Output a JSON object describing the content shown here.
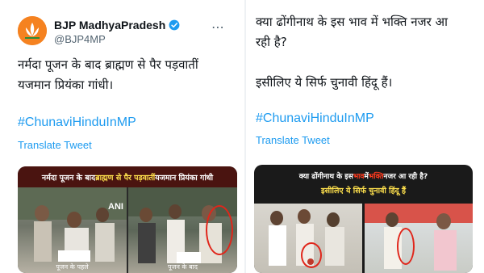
{
  "left_tweet": {
    "display_name": "BJP MadhyaPradesh",
    "handle": "@BJP4MP",
    "icons": {
      "avatar": "bjp-lotus-logo",
      "verified": "verified-badge-icon",
      "more": "more-options-icon"
    },
    "text_lines": [
      "नर्मदा पूजन के बाद ब्राह्मण से पैर पड़वातीं",
      "यजमान प्रियंका गांधी।"
    ],
    "hashtag": "#ChunaviHinduInMP",
    "translate_label": "Translate Tweet",
    "media": {
      "banner_parts": [
        {
          "text": "नर्मदा पूजन के बाद ",
          "style": "plain"
        },
        {
          "text": "ब्राह्मण से पैर पड़वातीं",
          "style": "red"
        },
        {
          "text": " यजमान प्रियंका गांधी",
          "style": "plain"
        }
      ],
      "watermark": "ANI",
      "caption_left": "पूजन के पहले",
      "caption_right": "पूजन के बाद"
    }
  },
  "right_tweet": {
    "text_lines": [
      "क्या ढोंगीनाथ के इस भाव में भक्ति नजर आ",
      "रही है?"
    ],
    "text_line_3": "इसीलिए ये सिर्फ चुनावी हिंदू हैं।",
    "hashtag": "#ChunaviHinduInMP",
    "translate_label": "Translate Tweet",
    "media": {
      "banner_line1_parts": [
        {
          "text": "क्या ढोंगीनाथ के इस ",
          "style": "plain"
        },
        {
          "text": "भाव",
          "style": "red"
        },
        {
          "text": " में ",
          "style": "plain"
        },
        {
          "text": "भक्ति",
          "style": "red"
        },
        {
          "text": " नजर आ रही है?",
          "style": "plain"
        }
      ],
      "banner_line2": "इसीलिए ये सिर्फ चुनावी हिंदू हैं"
    }
  },
  "colors": {
    "accent": "#1d9bf0",
    "text": "#0f1419",
    "muted": "#536471",
    "banner_red": "#ff3b1f",
    "banner_yellow": "#ffe14d"
  }
}
